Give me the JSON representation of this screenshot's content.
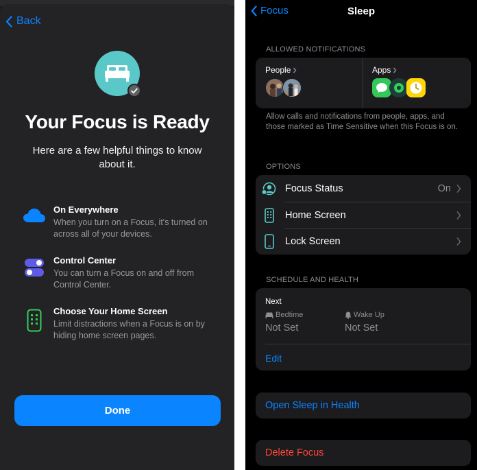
{
  "left": {
    "back_label": "Back",
    "title": "Your Focus is Ready",
    "subtitle": "Here are a few helpful things to know about it.",
    "features": [
      {
        "icon": "cloud-icon",
        "title": "On Everywhere",
        "desc": "When you turn on a Focus, it's turned on across all of your devices."
      },
      {
        "icon": "toggle-switches-icon",
        "title": "Control Center",
        "desc": "You can turn a Focus on and off from Control Center."
      },
      {
        "icon": "home-screen-phone-icon",
        "title": "Choose Your Home Screen",
        "desc": "Limit distractions when a Focus is on by hiding home screen pages."
      }
    ],
    "done_label": "Done"
  },
  "right": {
    "nav": {
      "back_label": "Focus",
      "title": "Sleep"
    },
    "allowed": {
      "header": "ALLOWED NOTIFICATIONS",
      "people_label": "People",
      "apps_label": "Apps",
      "description": "Allow calls and notifications from people, apps, and those marked as Time Sensitive when this Focus is on."
    },
    "options": {
      "header": "OPTIONS",
      "rows": [
        {
          "icon": "focus-status-icon",
          "label": "Focus Status",
          "value": "On"
        },
        {
          "icon": "home-screen-icon",
          "label": "Home Screen",
          "value": ""
        },
        {
          "icon": "lock-screen-icon",
          "label": "Lock Screen",
          "value": ""
        }
      ]
    },
    "schedule": {
      "header": "SCHEDULE AND HEALTH",
      "next_label": "Next",
      "bedtime_label": "Bedtime",
      "bedtime_value": "Not Set",
      "wakeup_label": "Wake Up",
      "wakeup_value": "Not Set",
      "edit_label": "Edit"
    },
    "open_health_label": "Open Sleep in Health",
    "delete_label": "Delete Focus"
  },
  "colors": {
    "accent": "#0a84ff",
    "destructive": "#ff453a",
    "focus_teal": "#5ac8c8",
    "messages_green": "#34c759",
    "clock_yellow": "#ffd60a"
  }
}
